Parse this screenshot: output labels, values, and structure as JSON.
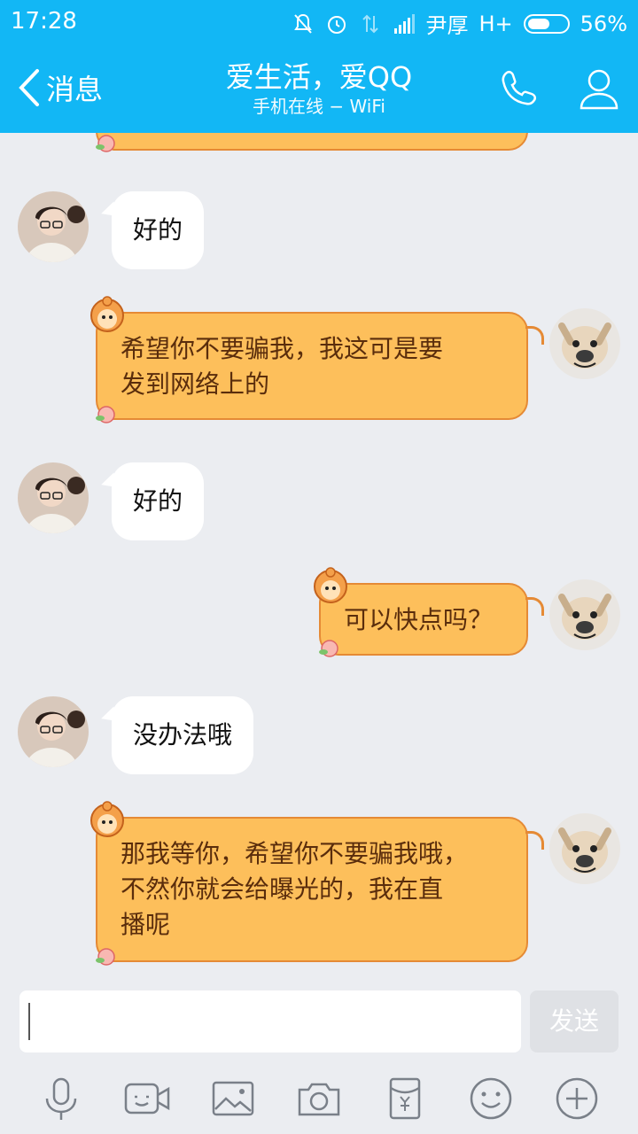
{
  "status_bar": {
    "time": "17:28",
    "carrier": "尹厚",
    "network": "H+",
    "battery": "56%",
    "battery_level": 0.56
  },
  "header": {
    "back_label": "消息",
    "title": "爱生活，爱QQ",
    "subtitle": "手机在线 − WiFi"
  },
  "messages": [
    {
      "side": "left",
      "text": "好的"
    },
    {
      "side": "right",
      "lines": [
        "希望你不要骗我，我这可是要",
        "发到网络上的"
      ]
    },
    {
      "side": "left",
      "text": "好的"
    },
    {
      "side": "right",
      "lines": [
        "可以快点吗？"
      ]
    },
    {
      "side": "left",
      "text": "没办法哦"
    },
    {
      "side": "right",
      "lines": [
        "那我等你，希望你不要骗我哦，",
        "不然你就会给曝光的，我在直",
        "播呢"
      ]
    }
  ],
  "composer": {
    "value": "",
    "send_label": "发送"
  },
  "toolbar_icons": [
    "microphone-icon",
    "video-icon",
    "image-icon",
    "camera-icon",
    "red-packet-icon",
    "emoji-icon",
    "plus-icon"
  ],
  "colors": {
    "header_blue": "#12b7f5",
    "bubble_orange": "#fdbf5b",
    "bubble_border": "#e58a35"
  }
}
